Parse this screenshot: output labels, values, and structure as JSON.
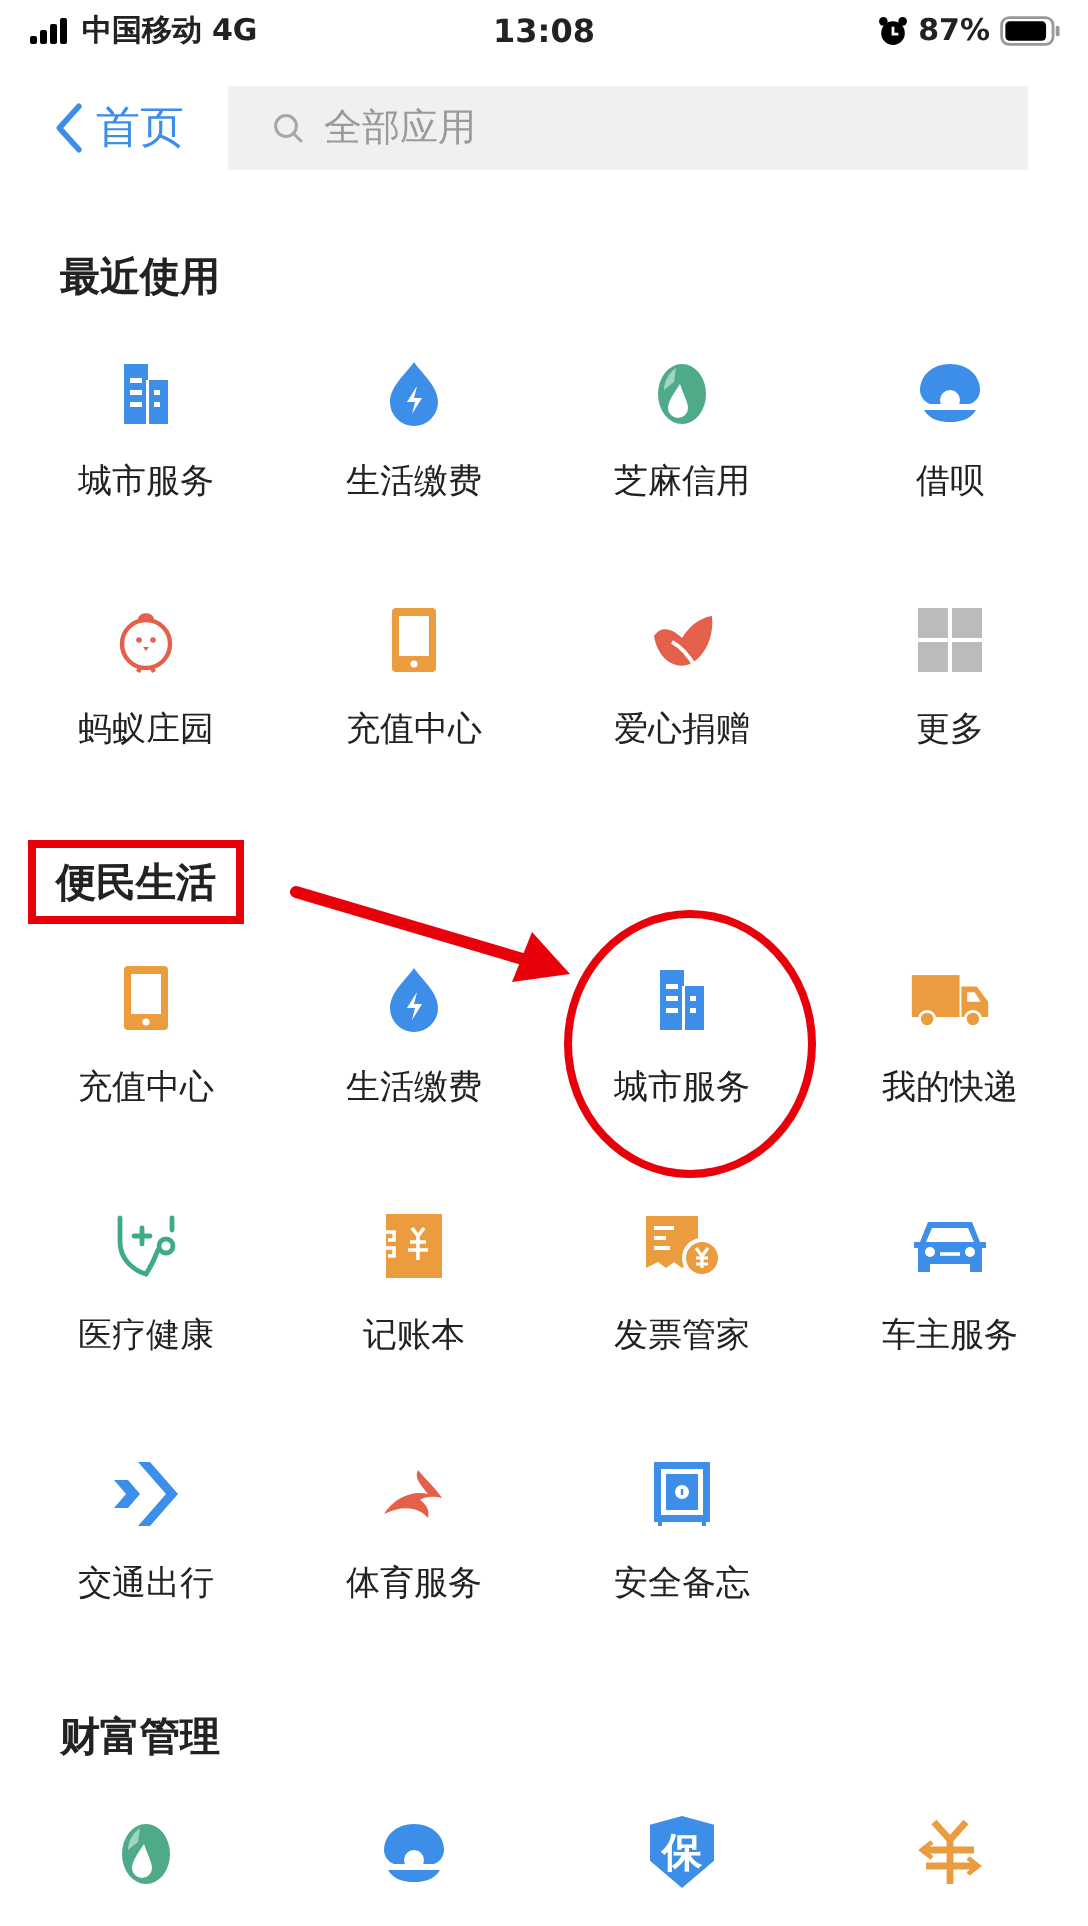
{
  "status_bar": {
    "carrier": "中国移动",
    "network": "4G",
    "time": "13:08",
    "battery": "87%"
  },
  "nav": {
    "back_label": "首页",
    "search": {
      "placeholder": "全部应用"
    }
  },
  "sections": [
    {
      "title": "最近使用",
      "boxed": false,
      "items": [
        {
          "kind": "building",
          "label": "城市服务",
          "circled": false
        },
        {
          "kind": "bolt-drop",
          "label": "生活缴费",
          "circled": false
        },
        {
          "kind": "seed-drop",
          "label": "芝麻信用",
          "circled": false
        },
        {
          "kind": "shell",
          "label": "借呗",
          "circled": false
        },
        {
          "kind": "chick",
          "label": "蚂蚁庄园",
          "circled": false
        },
        {
          "kind": "phone",
          "label": "充值中心",
          "circled": false
        },
        {
          "kind": "leaf",
          "label": "爱心捐赠",
          "circled": false
        },
        {
          "kind": "grid",
          "label": "更多",
          "circled": false
        }
      ]
    },
    {
      "title": "便民生活",
      "boxed": true,
      "items": [
        {
          "kind": "phone",
          "label": "充值中心",
          "circled": false
        },
        {
          "kind": "bolt-drop",
          "label": "生活缴费",
          "circled": false
        },
        {
          "kind": "building",
          "label": "城市服务",
          "circled": true
        },
        {
          "kind": "truck",
          "label": "我的快递",
          "circled": false
        },
        {
          "kind": "stethoscope",
          "label": "医疗健康",
          "circled": false
        },
        {
          "kind": "ledger",
          "label": "记账本",
          "circled": false
        },
        {
          "kind": "invoice",
          "label": "发票管家",
          "circled": false
        },
        {
          "kind": "car",
          "label": "车主服务",
          "circled": false
        },
        {
          "kind": "chevrons",
          "label": "交通出行",
          "circled": false
        },
        {
          "kind": "swoosh",
          "label": "体育服务",
          "circled": false
        },
        {
          "kind": "safe",
          "label": "安全备忘",
          "circled": false
        }
      ]
    },
    {
      "title": "财富管理",
      "boxed": false,
      "items": [
        {
          "kind": "seed-drop",
          "circled": false
        },
        {
          "kind": "shell",
          "circled": false
        },
        {
          "kind": "shield",
          "glyph": "保",
          "circled": false
        },
        {
          "kind": "yuan-arrows",
          "circled": false
        }
      ]
    }
  ]
}
